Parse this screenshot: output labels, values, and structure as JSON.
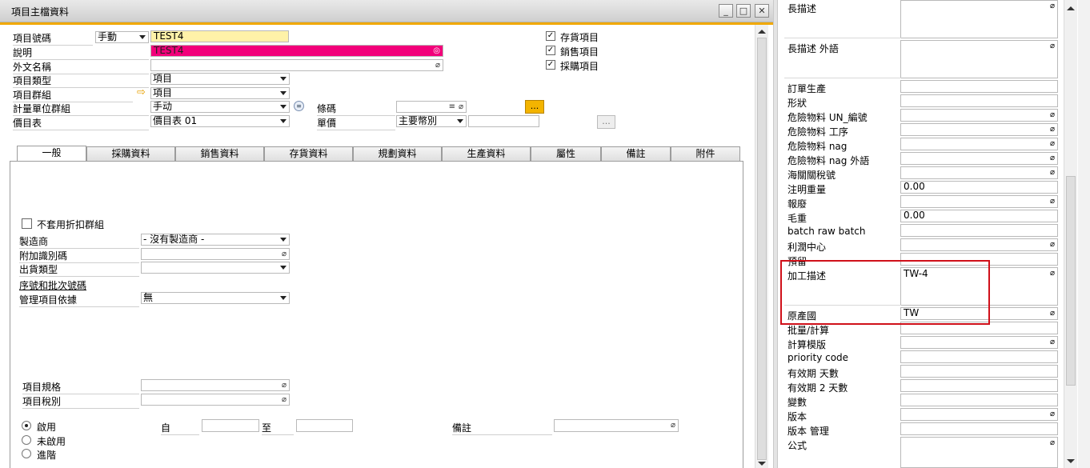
{
  "window": {
    "title": "項目主檔資料",
    "min_label": "_",
    "max_label": "□",
    "close_label": "✕"
  },
  "header": {
    "item_code_label": "項目號碼",
    "numbering_mode": "手動",
    "item_code": "TEST4",
    "description_label": "說明",
    "description": "TEST4",
    "foreign_name_label": "外文名稱",
    "item_type_label": "項目類型",
    "item_type": "項目",
    "item_group_label": "項目群組",
    "item_group": "項目",
    "uom_group_label": "計量單位群組",
    "uom_group": "手动",
    "price_list_label": "價目表",
    "price_list": "價目表 01",
    "barcode_label": "條碼",
    "unit_price_label": "單價",
    "currency": "主要幣別",
    "inventory_item_label": "存貨項目",
    "sales_item_label": "銷售項目",
    "purchase_item_label": "採購項目",
    "dots": "..."
  },
  "tabs": [
    "一般",
    "採購資料",
    "銷售資料",
    "存貨資料",
    "規劃資料",
    "生產資料",
    "屬性",
    "備註",
    "附件"
  ],
  "general": {
    "no_discount_label": "不套用折扣群組",
    "manufacturer_label": "製造商",
    "manufacturer": "- 沒有製造商 -",
    "additional_id_label": "附加識別碼",
    "shipping_type_label": "出貨類型",
    "serial_batch_label": "序號和批次號碼",
    "manage_by_label": "管理項目依據",
    "manage_by": "無",
    "spec_label": "項目規格",
    "tax_label": "項目稅別",
    "active_label": "啟用",
    "inactive_label": "未啟用",
    "advanced_label": "進階",
    "from_label": "自",
    "to_label": "至",
    "remarks_label": "備註",
    "dots": "..."
  },
  "right_panel": {
    "rows": [
      {
        "label": "長描述",
        "value": ""
      },
      {
        "label": "長描述 外語",
        "value": ""
      },
      {
        "label": "訂單生產",
        "value": ""
      },
      {
        "label": "形狀",
        "value": ""
      },
      {
        "label": "危險物料 UN_編號",
        "value": ""
      },
      {
        "label": "危險物料 工序",
        "value": ""
      },
      {
        "label": "危險物料 nag",
        "value": ""
      },
      {
        "label": "危險物料 nag 外語",
        "value": ""
      },
      {
        "label": "海關關稅號",
        "value": ""
      },
      {
        "label": "注明重量",
        "value": "0.00"
      },
      {
        "label": "報廢",
        "value": ""
      },
      {
        "label": "毛重",
        "value": "0.00"
      },
      {
        "label": "batch raw batch",
        "value": ""
      },
      {
        "label": "利潤中心",
        "value": ""
      },
      {
        "label": "預留",
        "value": ""
      },
      {
        "label": "加工描述",
        "value": "TW-4"
      },
      {
        "label": "原產國",
        "value": "TW"
      },
      {
        "label": "批量/計算",
        "value": ""
      },
      {
        "label": "計算模版",
        "value": ""
      },
      {
        "label": "priority code",
        "value": ""
      },
      {
        "label": "有效期 天數",
        "value": ""
      },
      {
        "label": "有效期 2 天數",
        "value": ""
      },
      {
        "label": "變數",
        "value": ""
      },
      {
        "label": "版本",
        "value": ""
      },
      {
        "label": "版本 管理",
        "value": ""
      },
      {
        "label": "公式",
        "value": ""
      }
    ]
  },
  "colors": {
    "accent": "#f0a800",
    "code_field": "#fff2a8",
    "desc_field": "#f2007a",
    "highlight_box": "#d0101a"
  }
}
